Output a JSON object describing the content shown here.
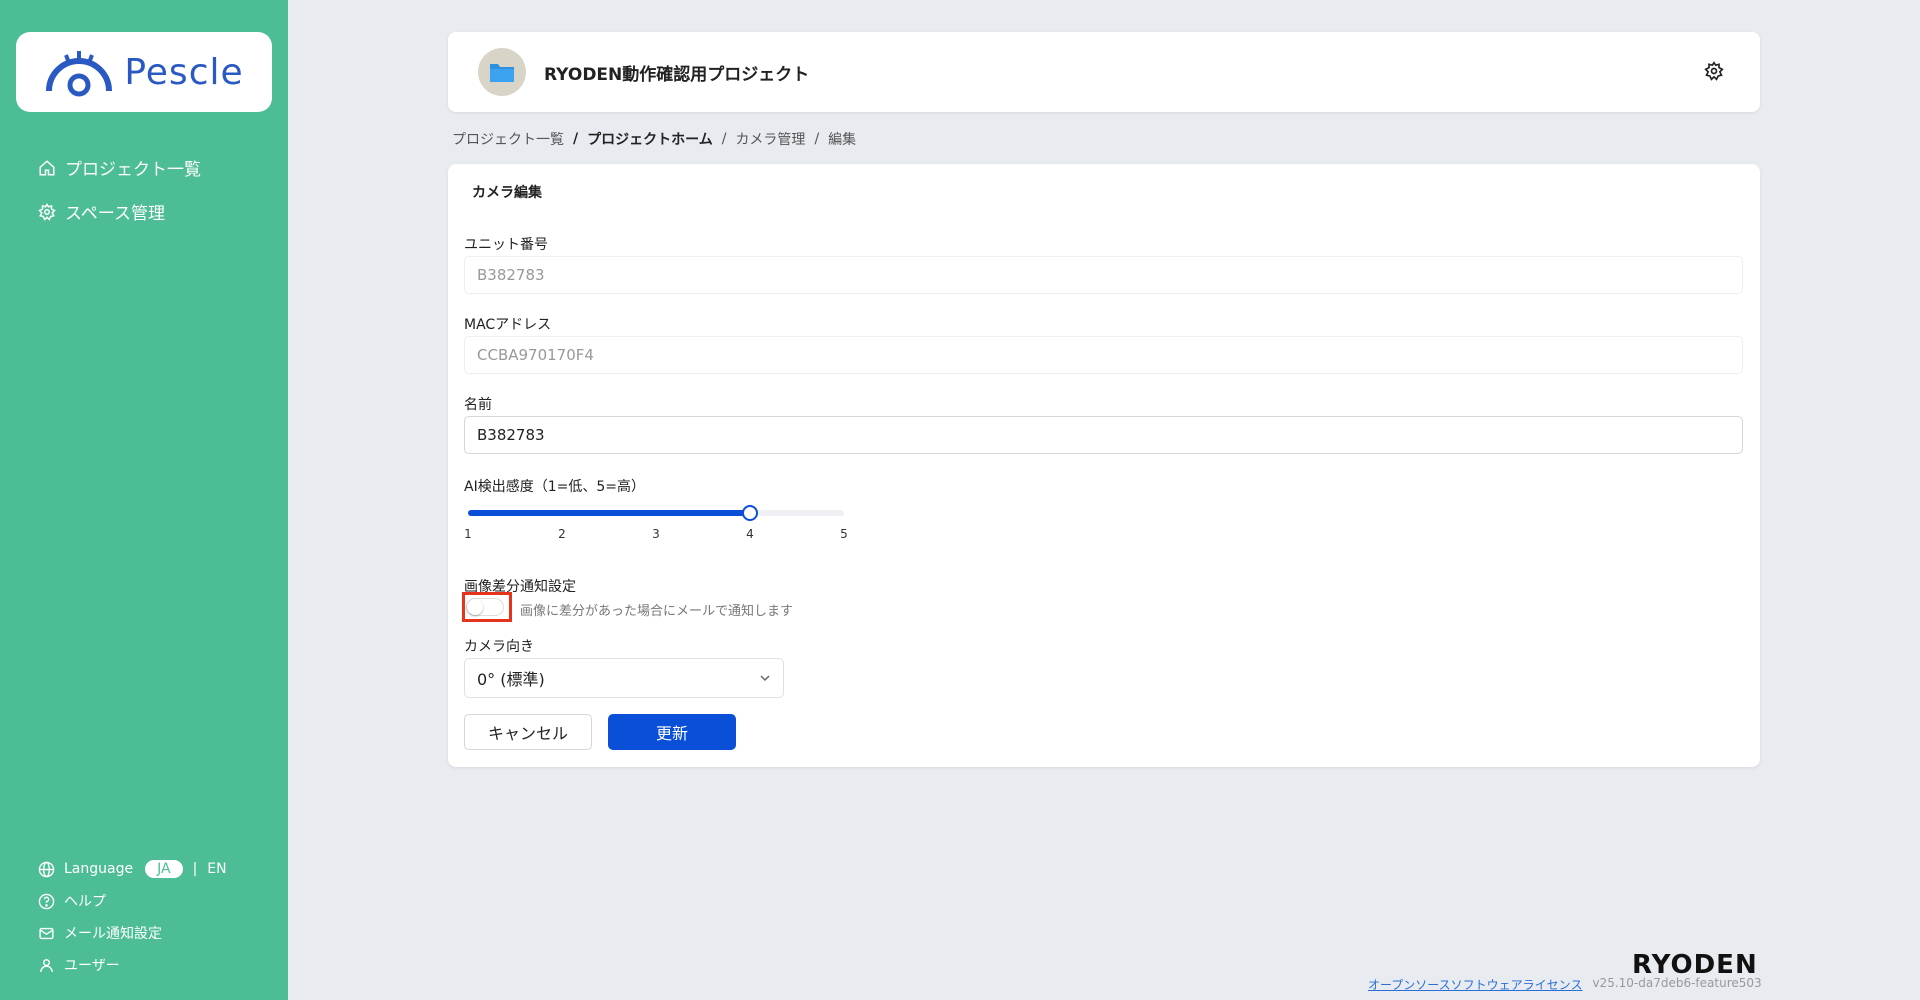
{
  "sidebar": {
    "logo_text": "Pescle",
    "nav": [
      {
        "label": "プロジェクト一覧",
        "icon": "home-icon"
      },
      {
        "label": "スペース管理",
        "icon": "gear-icon"
      }
    ],
    "language_label": "Language",
    "language_active": "JA",
    "language_sep": "|",
    "language_other": "EN",
    "help_label": "ヘルプ",
    "mail_label": "メール通知設定",
    "user_label": "ユーザー"
  },
  "header": {
    "project_title": "RYODEN動作確認用プロジェクト"
  },
  "breadcrumb": {
    "items": [
      "プロジェクト一覧",
      "プロジェクトホーム",
      "カメラ管理",
      "編集"
    ],
    "sep": "/"
  },
  "form": {
    "title": "カメラ編集",
    "unit_label": "ユニット番号",
    "unit_value": "B382783",
    "mac_label": "MACアドレス",
    "mac_value": "CCBA970170F4",
    "name_label": "名前",
    "name_value": "B382783",
    "sensitivity_label": "AI検出感度（1=低、5=高）",
    "sensitivity_ticks": [
      "1",
      "2",
      "3",
      "4",
      "5"
    ],
    "sensitivity_value": 4,
    "sensitivity_min": 1,
    "sensitivity_max": 5,
    "diff_label": "画像差分通知設定",
    "diff_enabled": false,
    "diff_desc": "画像に差分があった場合にメールで通知します",
    "orientation_label": "カメラ向き",
    "orientation_value": "0° (標準)",
    "cancel_label": "キャンセル",
    "update_label": "更新"
  },
  "footer": {
    "logo": "RYODEN",
    "license_link": "オープンソースソフトウェアライセンス",
    "version": "v25.10-da7deb6-feature503"
  },
  "colors": {
    "sidebar": "#4dbd95",
    "primary": "#0a4fd8",
    "highlight": "#e8331c"
  }
}
